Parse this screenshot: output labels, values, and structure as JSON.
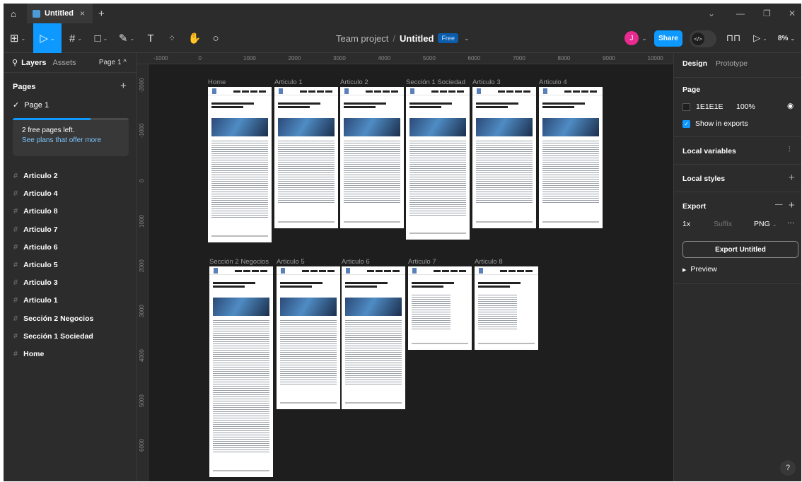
{
  "tabbar": {
    "tab_title": "Untitled",
    "close": "×",
    "plus": "+"
  },
  "toolbar": {
    "project": "Team project",
    "separator": "/",
    "file_name": "Untitled",
    "plan_badge": "Free",
    "avatar_initial": "J",
    "share_label": "Share",
    "zoom": "8%",
    "text_tool": "T"
  },
  "left_panel": {
    "tab_layers": "Layers",
    "tab_assets": "Assets",
    "current_page": "Page 1",
    "pages_heading": "Pages",
    "page_item": "Page 1",
    "promo_line1": "2 free pages left.",
    "promo_line2": "See plans that offer more",
    "layers": [
      "Articulo 2",
      "Articulo 4",
      "Articulo 8",
      "Articulo 7",
      "Articulo 6",
      "Articulo 5",
      "Articulo 3",
      "Articulo 1",
      "Sección 2 Negocios",
      "Sección 1 Sociedad",
      "Home"
    ]
  },
  "right_panel": {
    "tab_design": "Design",
    "tab_prototype": "Prototype",
    "page_heading": "Page",
    "bg_color": "1E1E1E",
    "bg_opacity": "100%",
    "show_in_exports": "Show in exports",
    "local_variables": "Local variables",
    "local_styles": "Local styles",
    "export_heading": "Export",
    "export_scale": "1x",
    "export_suffix_placeholder": "Suffix",
    "export_format": "PNG",
    "export_button": "Export Untitled",
    "preview": "Preview",
    "help": "?"
  },
  "rulers": {
    "top": [
      "-1000",
      "0",
      "1000",
      "2000",
      "3000",
      "4000",
      "5000",
      "6000",
      "7000",
      "8000",
      "9000",
      "10000"
    ],
    "left": [
      "-2000",
      "-1000",
      "0",
      "1000",
      "2000",
      "3000",
      "4000",
      "5000",
      "6000"
    ]
  },
  "canvas": {
    "frames_row1": [
      "Home",
      "Articulo 1",
      "Articulo 2",
      "Sección 1 Sociedad",
      "Articulo 3",
      "Articulo 4"
    ],
    "frames_row2": [
      "Sección 2 Negocios",
      "Articulo 5",
      "Articulo 6",
      "Articulo 7",
      "Articulo 8"
    ]
  },
  "colors": {
    "accent": "#0d99ff",
    "avatar": "#e82b8e",
    "canvas_bg": "#1e1e1e",
    "panel_bg": "#2c2c2c"
  }
}
